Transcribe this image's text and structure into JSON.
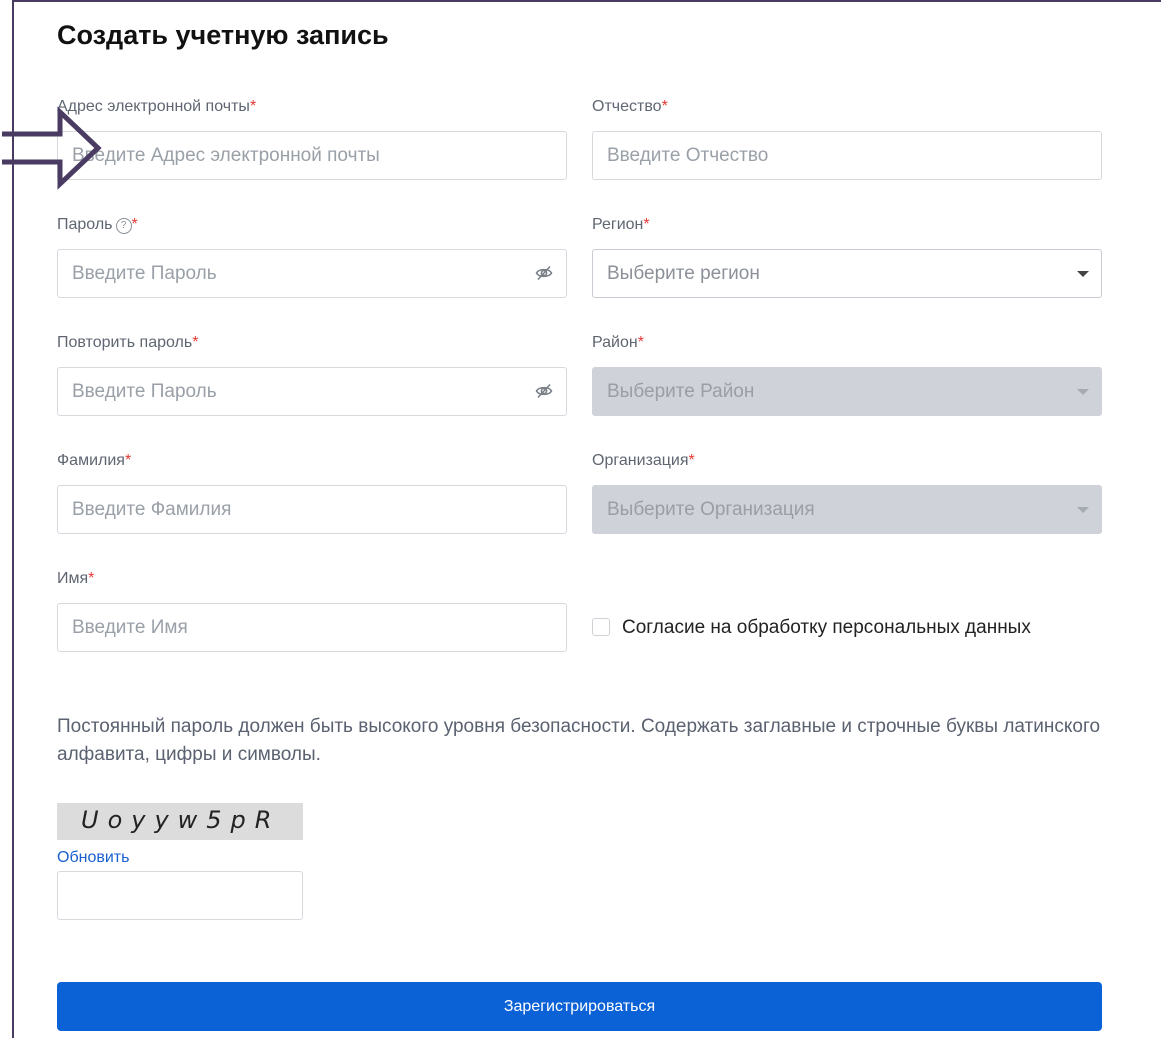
{
  "title": "Создать учетную запись",
  "required_mark": "*",
  "fields": {
    "email": {
      "label": "Адрес электронной почты",
      "placeholder": "Введите Адрес электронной почты"
    },
    "password": {
      "label": "Пароль",
      "help_icon": "question-circle-icon",
      "placeholder": "Введите Пароль"
    },
    "password_repeat": {
      "label": "Повторить пароль",
      "placeholder": "Введите Пароль"
    },
    "last_name": {
      "label": "Фамилия",
      "placeholder": "Введите Фамилия"
    },
    "first_name": {
      "label": "Имя",
      "placeholder": "Введите Имя"
    },
    "patronymic": {
      "label": "Отчество",
      "placeholder": "Введите Отчество"
    },
    "region": {
      "label": "Регион",
      "value": "Выберите регион",
      "disabled": false
    },
    "district": {
      "label": "Район",
      "value": "Выберите Район",
      "disabled": true
    },
    "organization": {
      "label": "Организация",
      "value": "Выберите Организация",
      "disabled": true
    }
  },
  "consent": {
    "label": "Согласие на обработку персональных данных",
    "checked": false
  },
  "password_hint": "Постоянный пароль должен быть высокого уровня безопасности. Содержать заглавные и строчные буквы латинского алфавита, цифры и символы.",
  "captcha": {
    "code": "Uoyyw5pR",
    "refresh_label": "Обновить",
    "input_value": ""
  },
  "submit_label": "Зарегистрироваться",
  "colors": {
    "primary": "#0b62d6",
    "required": "#e53935",
    "disabled_bg": "#cfd2d8",
    "annotation_arrow": "#4a3b63"
  },
  "icons": [
    "eye-slash-icon",
    "chevron-down-icon",
    "question-circle-icon",
    "annotation-arrow-icon"
  ]
}
